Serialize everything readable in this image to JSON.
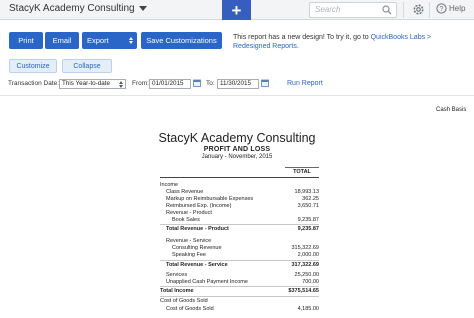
{
  "topbar": {
    "company": "StacyK Academy Consulting",
    "plus": "+",
    "search_placeholder": "Search",
    "help": "Help",
    "icons": [
      "caret-down-icon",
      "plus-icon",
      "search-icon",
      "gear-icon",
      "help-icon"
    ]
  },
  "toolbar": {
    "print": "Print",
    "email": "Email",
    "export": "Export",
    "save_customizations": "Save Customizations",
    "customize": "Customize",
    "collapse": "Collapse"
  },
  "notice": {
    "text": "This report has a new design! To try it, go to ",
    "link": "QuickBooks Labs > Redesigned Reports."
  },
  "filters": {
    "transaction_date_label": "Transaction Date:",
    "transaction_date_value": "This Year-to-date",
    "from_label": "From:",
    "from_value": "01/01/2015",
    "to_label": "To:",
    "to_value": "11/30/2015",
    "run_report": "Run Report"
  },
  "report": {
    "basis": "Cash Basis",
    "company": "StacyK Academy Consulting",
    "title": "PROFIT AND LOSS",
    "period": "January - November, 2015",
    "column_header": "TOTAL",
    "rows": [
      {
        "label": "Income",
        "value": "",
        "bold": false,
        "indent": 0
      },
      {
        "label": "Class Revenue",
        "value": "18,993.13",
        "bold": false,
        "indent": 1
      },
      {
        "label": "Markup on Reimbursable Expenses",
        "value": "362.25",
        "bold": false,
        "indent": 1
      },
      {
        "label": "Reimbursed Exp. (Income)",
        "value": "3,650.71",
        "bold": false,
        "indent": 1
      },
      {
        "label": "Revenue - Product",
        "value": "",
        "bold": false,
        "indent": 1
      },
      {
        "label": "Book Sales",
        "value": "9,235.87",
        "bold": false,
        "indent": 2
      },
      {
        "label": "Total Revenue - Product",
        "value": "9,235.87",
        "bold": true,
        "indent": 1
      },
      {
        "label": "Revenue - Service",
        "value": "",
        "bold": false,
        "indent": 1
      },
      {
        "label": "Consulting Revenue",
        "value": "315,322.69",
        "bold": false,
        "indent": 2
      },
      {
        "label": "Speaking Fee",
        "value": "2,000.00",
        "bold": false,
        "indent": 2
      },
      {
        "label": "Total Revenue - Service",
        "value": "317,322.69",
        "bold": true,
        "indent": 1
      },
      {
        "label": "Services",
        "value": "25,250.00",
        "bold": false,
        "indent": 1
      },
      {
        "label": "Unapplied Cash Payment Income",
        "value": "700.00",
        "bold": false,
        "indent": 1
      },
      {
        "label": "Total Income",
        "value": "$375,514.65",
        "bold": true,
        "indent": 0
      },
      {
        "label": "Cost of Goods Sold",
        "value": "",
        "bold": false,
        "indent": 0
      },
      {
        "label": "Cost of Goods Sold",
        "value": "4,185.00",
        "bold": false,
        "indent": 1
      }
    ]
  },
  "colors": {
    "primary_button": "#2a66c8",
    "plus_button": "#365ebf",
    "link": "#2a66c8",
    "secondary_button_bg": "#e4eef9"
  }
}
